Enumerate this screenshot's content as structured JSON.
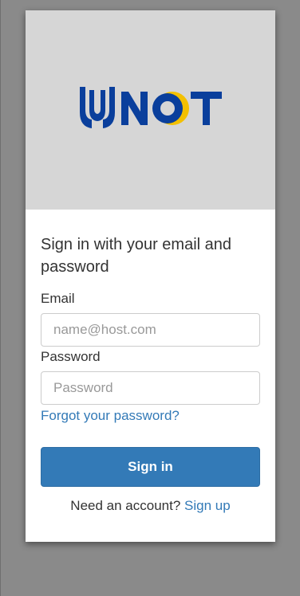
{
  "brand": {
    "logo_text": "YNOT",
    "colors": {
      "blue": "#0a3f9c",
      "yellow": "#f3c000",
      "banner_bg": "#d6d6d6"
    }
  },
  "form": {
    "heading": "Sign in with your email and password",
    "email_label": "Email",
    "email_placeholder": "name@host.com",
    "email_value": "",
    "password_label": "Password",
    "password_placeholder": "Password",
    "password_value": "",
    "forgot_link": "Forgot your password?",
    "submit_label": "Sign in",
    "signup_prompt": "Need an account?",
    "signup_link": "Sign up"
  },
  "colors": {
    "accent": "#337ab7",
    "page_bg": "#8a8a8a"
  }
}
